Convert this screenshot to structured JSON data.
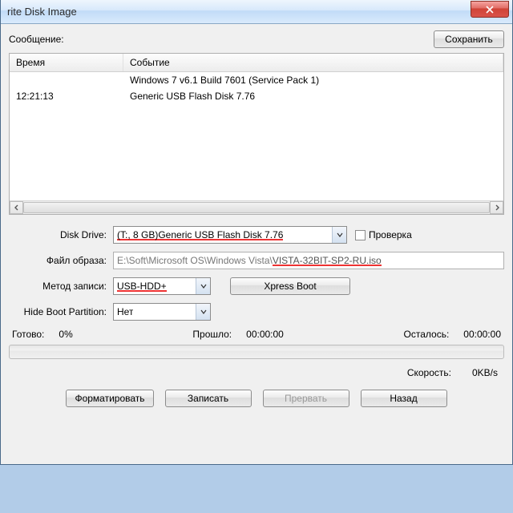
{
  "title": "rite Disk Image",
  "message_label": "Сообщение:",
  "save_button": "Сохранить",
  "log": {
    "col_time": "Время",
    "col_event": "Событие",
    "rows": [
      {
        "time": "",
        "event": "Windows 7 v6.1 Build 7601 (Service Pack 1)"
      },
      {
        "time": "12:21:13",
        "event": "Generic USB Flash Disk  7.76"
      }
    ]
  },
  "labels": {
    "disk_drive": "Disk Drive:",
    "image_file": "Файл образа:",
    "write_method": "Метод записи:",
    "hide_boot": "Hide Boot Partition:",
    "check": "Проверка"
  },
  "values": {
    "disk_drive": "(T:, 8 GB)Generic USB Flash Disk  7.76",
    "image_file_prefix": "E:\\Soft\\Microsoft OS\\Windows Vista\\",
    "image_file_hl": "VISTA-32BIT-SP2-RU.iso",
    "write_method": "USB-HDD+",
    "hide_boot": "Нет"
  },
  "xpress_boot": "Xpress Boot",
  "status": {
    "ready": "Готово:",
    "ready_val": "0%",
    "elapsed": "Прошло:",
    "elapsed_val": "00:00:00",
    "remaining": "Осталось:",
    "remaining_val": "00:00:00",
    "speed": "Скорость:",
    "speed_val": "0KB/s"
  },
  "buttons": {
    "format": "Форматировать",
    "write": "Записать",
    "abort": "Прервать",
    "back": "Назад"
  }
}
